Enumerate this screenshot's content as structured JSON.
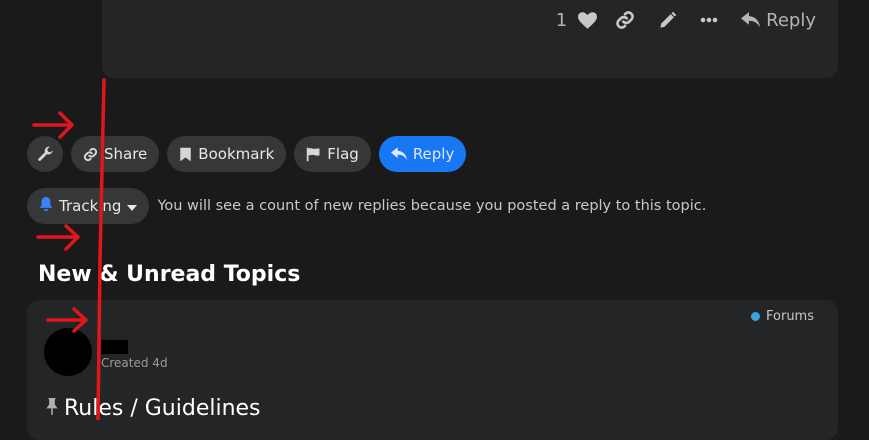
{
  "post": {
    "like_count": "1",
    "reply_label": "Reply",
    "icons": {
      "like": "heart-icon",
      "copy_link": "link-icon",
      "edit": "pencil-icon",
      "more": "ellipsis-icon",
      "reply": "reply-arrow-icon"
    }
  },
  "topic_controls": {
    "admin_icon": "wrench-icon",
    "share_label": "Share",
    "bookmark_label": "Bookmark",
    "flag_label": "Flag",
    "reply_label": "Reply"
  },
  "notifications": {
    "level_label": "Tracking",
    "description": "You will see a count of new replies because you posted a reply to this topic."
  },
  "suggested": {
    "heading": "New & Unread Topics",
    "topics": [
      {
        "category": "Forums",
        "created": "Created 4d",
        "title": "Rules / Guidelines"
      }
    ]
  },
  "colors": {
    "background": "#1a1a1b",
    "card": "#242526",
    "button": "#363738",
    "primary": "#1877f2",
    "category_dot": "#37a6e0",
    "annotation_red": "#e0161e"
  }
}
